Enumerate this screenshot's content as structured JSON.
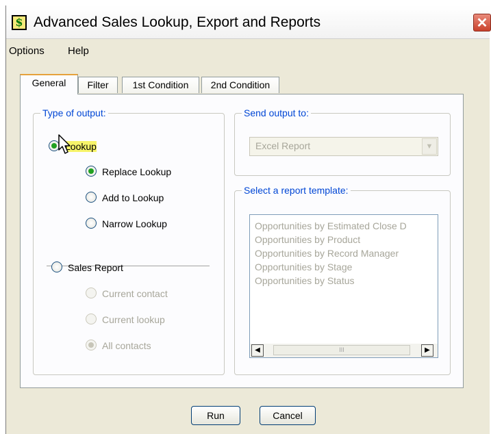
{
  "window": {
    "title": "Advanced Sales Lookup, Export and Reports",
    "icon_glyph": "$",
    "close_glyph": "✕"
  },
  "menu": [
    {
      "label": "Options"
    },
    {
      "label": "Help"
    }
  ],
  "tabs": [
    {
      "label": "General",
      "active": true
    },
    {
      "label": "Filter",
      "active": false
    },
    {
      "label": "1st Condition",
      "active": false
    },
    {
      "label": "2nd Condition",
      "active": false
    }
  ],
  "output_type": {
    "title": "Type of output:",
    "lookup_label": "Lookup",
    "lookup_options": [
      {
        "label": "Replace Lookup",
        "checked": true
      },
      {
        "label": "Add to Lookup",
        "checked": false
      },
      {
        "label": "Narrow Lookup",
        "checked": false
      }
    ],
    "report_label": "Sales Report",
    "report_options": [
      {
        "label": "Current contact",
        "checked": false
      },
      {
        "label": "Current lookup",
        "checked": false
      },
      {
        "label": "All contacts",
        "checked": true
      }
    ]
  },
  "send_output": {
    "title": "Send output to:",
    "selected": "Excel Report"
  },
  "report_template": {
    "title": "Select a report template:",
    "items": [
      "Opportunities by Estimated Close D",
      "Opportunities by Product",
      "Opportunities by Record Manager",
      "Opportunities by Stage",
      "Opportunities by Status"
    ],
    "scroll_left": "◀",
    "scroll_right": "▶",
    "thumb_grip": "III"
  },
  "buttons": {
    "run": "Run",
    "cancel": "Cancel"
  }
}
